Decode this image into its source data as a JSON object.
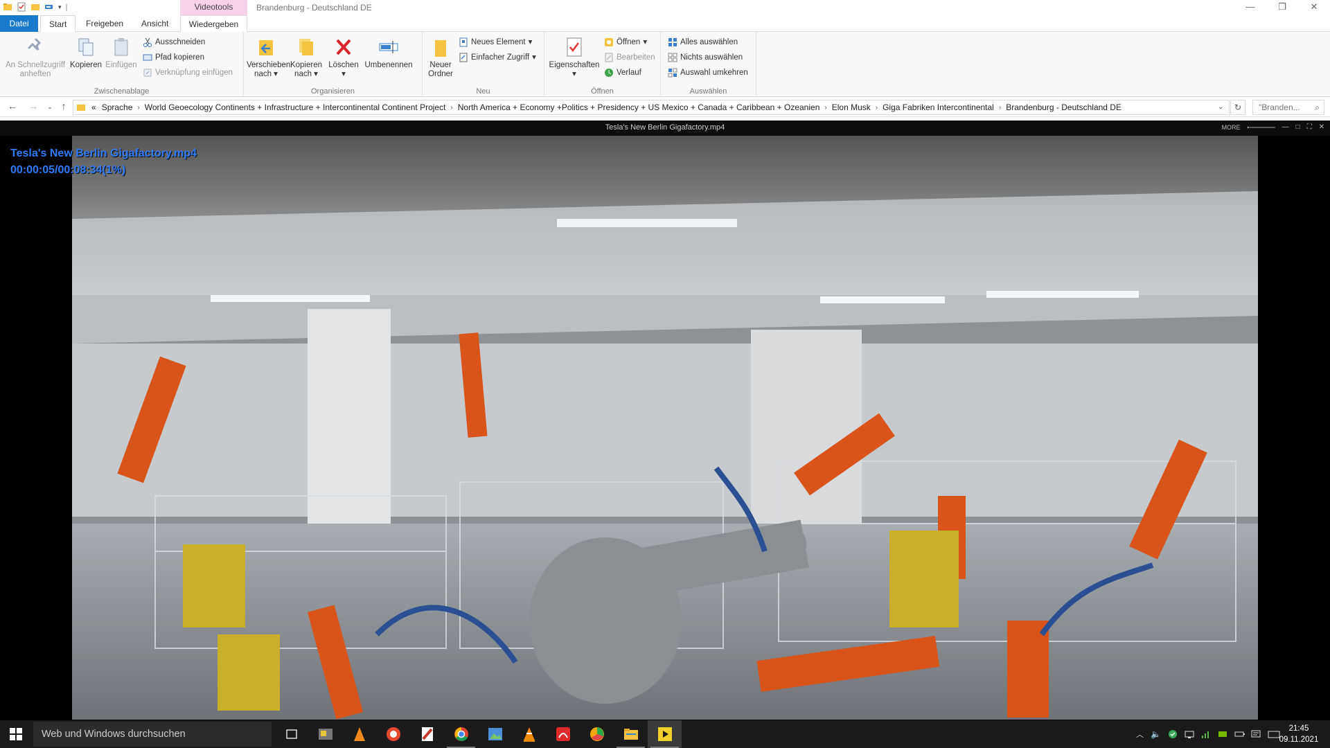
{
  "explorer": {
    "window_title": "Brandenburg - Deutschland DE",
    "contextual_tab_header": "Videotools",
    "tabs": [
      "Datei",
      "Start",
      "Freigeben",
      "Ansicht",
      "Wiedergeben"
    ],
    "ribbon": {
      "clipboard": {
        "label": "Zwischenablage",
        "pin_line1": "An Schnellzugriff",
        "pin_line2": "anheften",
        "copy": "Kopieren",
        "paste": "Einfügen",
        "cut": "Ausschneiden",
        "copy_path": "Pfad kopieren",
        "paste_shortcut": "Verknüpfung einfügen"
      },
      "organize": {
        "label": "Organisieren",
        "move_line1": "Verschieben",
        "move_line2": "nach",
        "copyto_line1": "Kopieren",
        "copyto_line2": "nach",
        "delete": "Löschen",
        "rename": "Umbenennen"
      },
      "new": {
        "label": "Neu",
        "folder_line1": "Neuer",
        "folder_line2": "Ordner",
        "new_item": "Neues Element",
        "easy_access": "Einfacher Zugriff"
      },
      "open": {
        "label": "Öffnen",
        "properties": "Eigenschaften",
        "open": "Öffnen",
        "edit": "Bearbeiten",
        "history": "Verlauf"
      },
      "select": {
        "label": "Auswählen",
        "select_all": "Alles auswählen",
        "select_none": "Nichts auswählen",
        "invert": "Auswahl umkehren"
      }
    },
    "breadcrumbs": [
      "«",
      "Sprache",
      "World Geoecology Continents + Infrastructure + Intercontinental Continent Project",
      "North America + Economy +Politics + Presidency + US  Mexico + Canada + Caribbean + Ozeanien",
      "Elon Musk",
      "Giga Fabriken Intercontinental",
      "Brandenburg - Deutschland DE"
    ],
    "search_placeholder": "\"Branden..."
  },
  "player": {
    "title": "Tesla's New Berlin Gigafactory.mp4",
    "osd_filename": "Tesla's New Berlin Gigafactory.mp4",
    "osd_time": "00:00:05/00:08:34(1%)",
    "more_label": "MORE",
    "progress_percent": 1
  },
  "taskbar": {
    "search_placeholder": "Web und Windows durchsuchen",
    "apps": [
      "task-view",
      "file-manager",
      "vlc-like",
      "chrome-like",
      "pdf-app",
      "chrome",
      "image-viewer",
      "vlc",
      "acrobat",
      "media-player",
      "file-explorer",
      "video-player"
    ],
    "clock_time": "21:45",
    "clock_date": "09.11.2021"
  },
  "colors": {
    "accent": "#1979ca",
    "contextual_tab": "#f5d2e8",
    "osd_text": "#2f7cff",
    "taskbar": "#1b1b1b"
  }
}
